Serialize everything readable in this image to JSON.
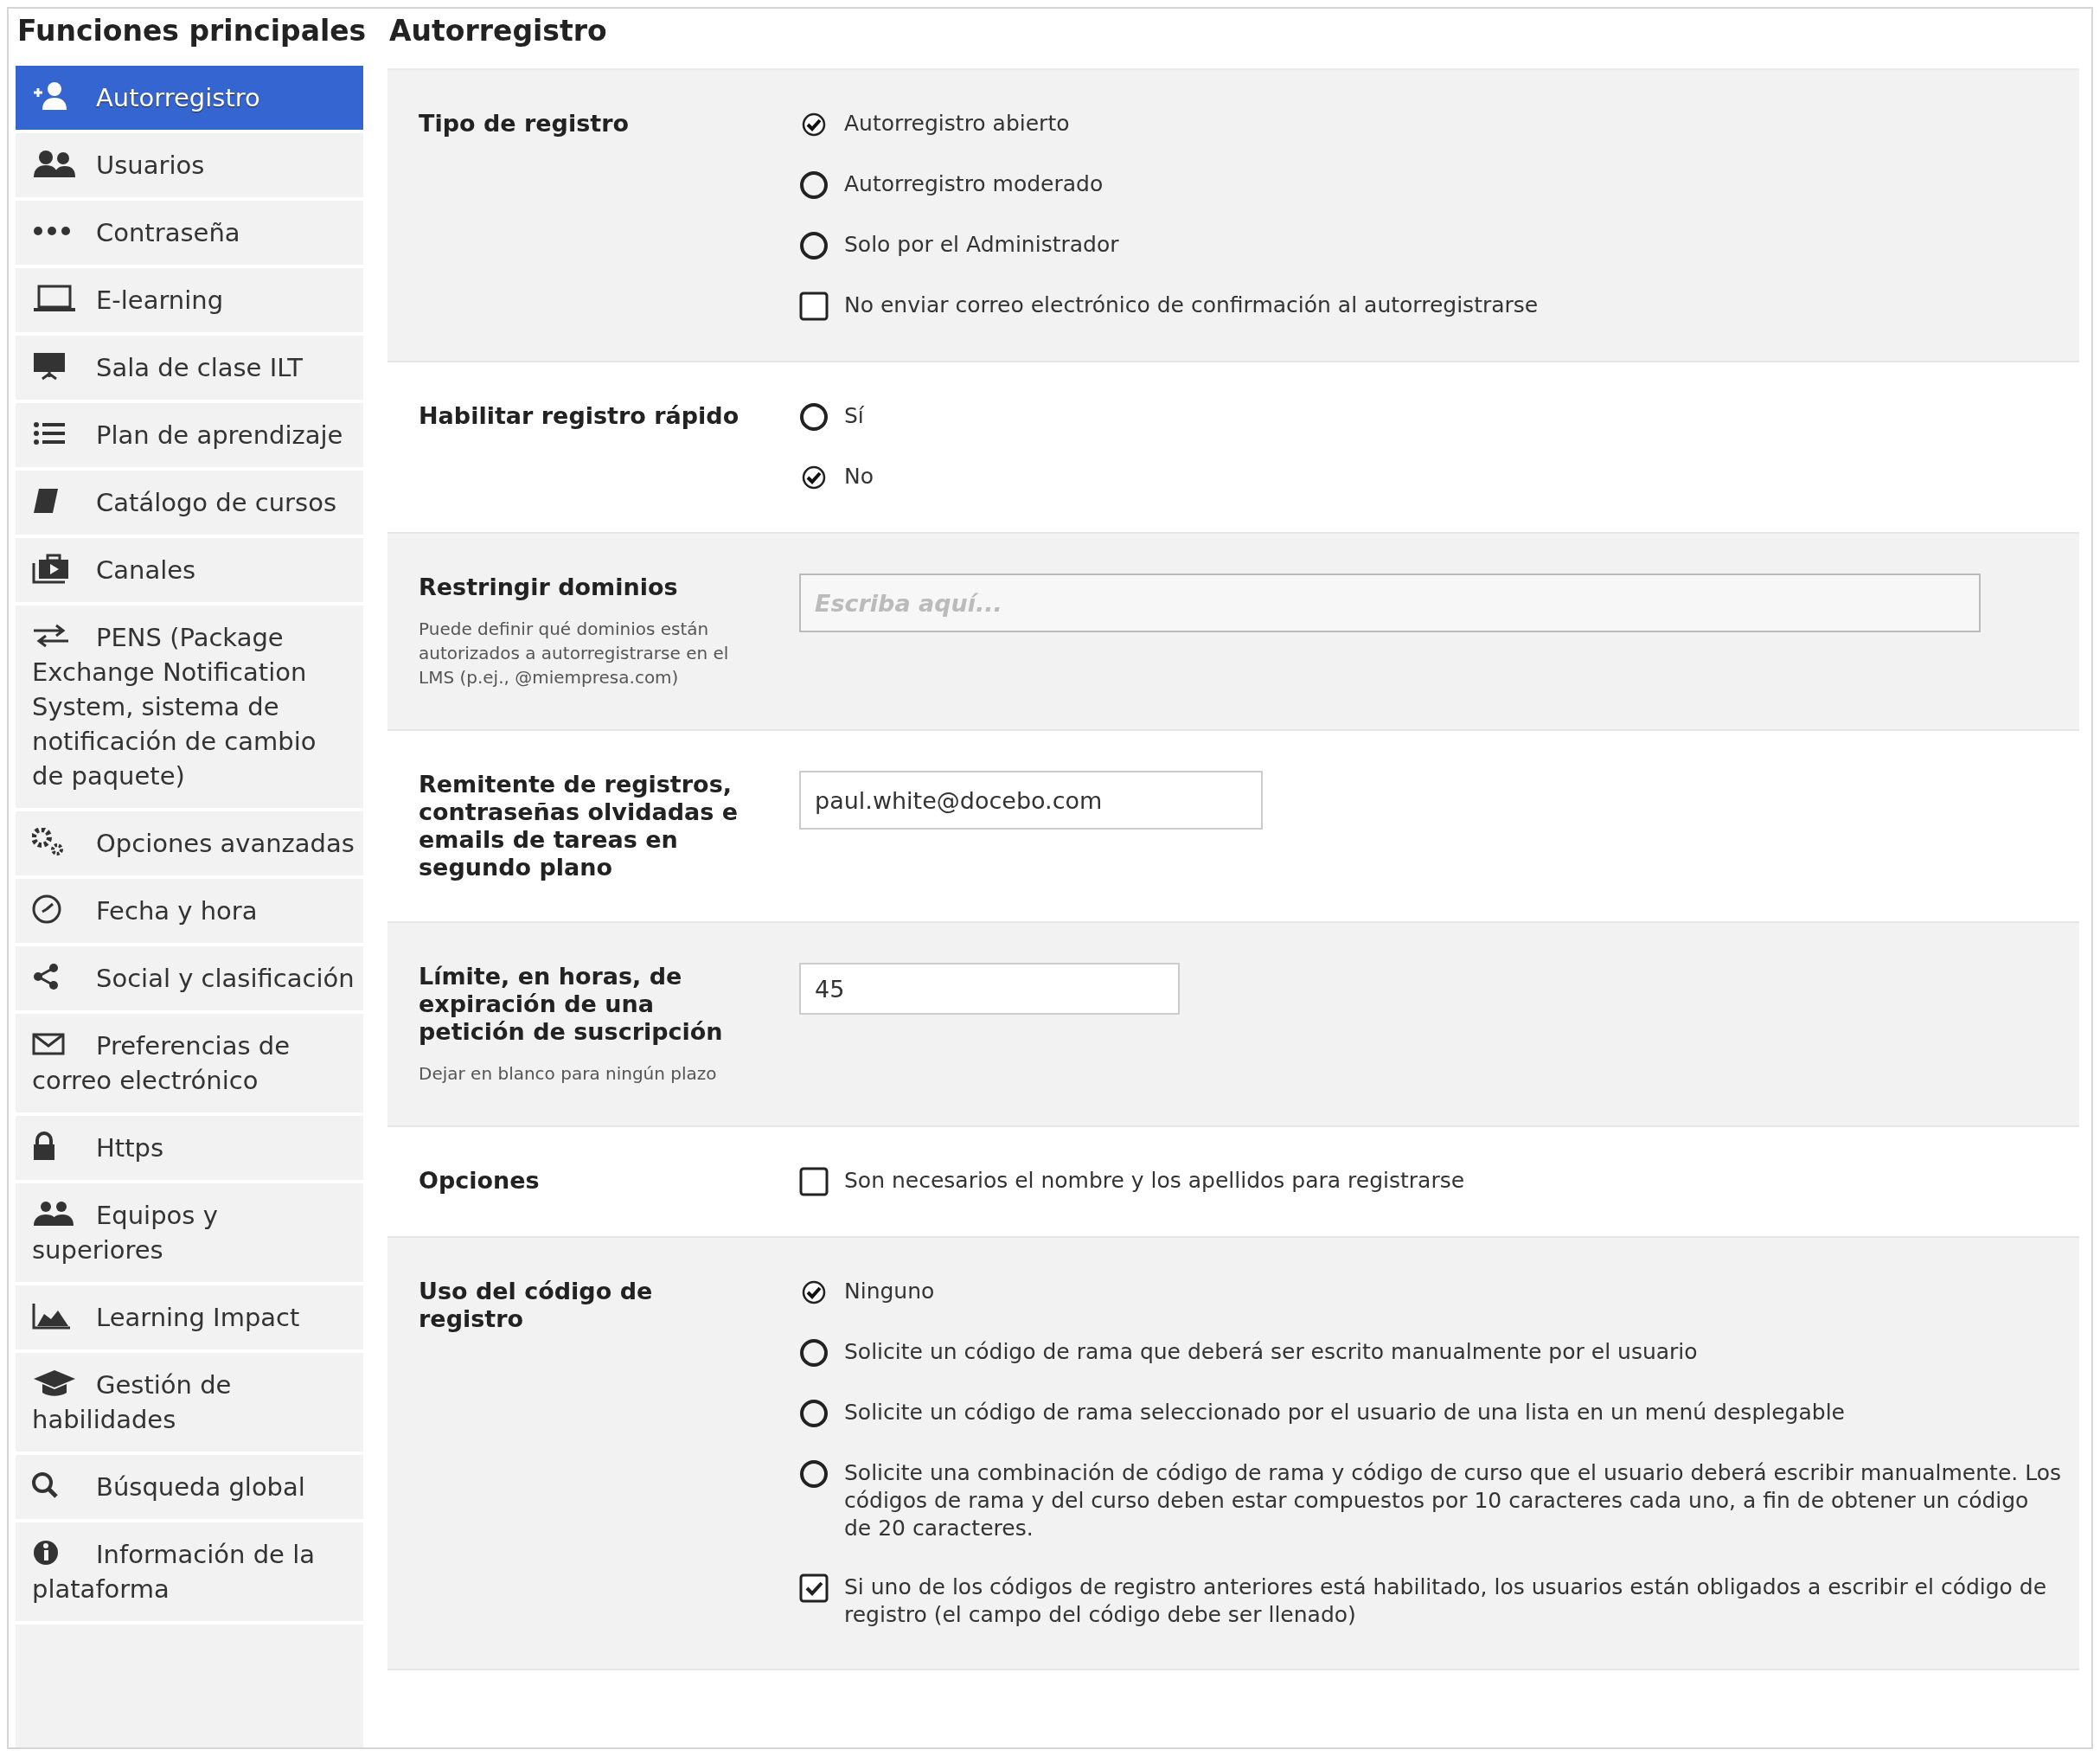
{
  "sidebar": {
    "title": "Funciones principales",
    "items": [
      {
        "label": "Autorregistro",
        "selected": true
      },
      {
        "label": "Usuarios",
        "selected": false
      },
      {
        "label": "Contraseña",
        "selected": false
      },
      {
        "label": "E-learning",
        "selected": false
      },
      {
        "label": "Sala de clase ILT",
        "selected": false
      },
      {
        "label": "Plan de aprendizaje",
        "selected": false
      },
      {
        "label": "Catálogo de cursos",
        "selected": false
      },
      {
        "label": "Canales",
        "selected": false
      },
      {
        "label": "PENS (Package Exchange Notification System, sistema de notificación de cambio de paquete)",
        "selected": false
      },
      {
        "label": "Opciones avanzadas",
        "selected": false
      },
      {
        "label": "Fecha y hora",
        "selected": false
      },
      {
        "label": "Social y clasificación",
        "selected": false
      },
      {
        "label": "Preferencias de correo electrónico",
        "selected": false
      },
      {
        "label": "Https",
        "selected": false
      },
      {
        "label": "Equipos y superiores",
        "selected": false
      },
      {
        "label": "Learning Impact",
        "selected": false
      },
      {
        "label": "Gestión de habilidades",
        "selected": false
      },
      {
        "label": "Búsqueda global",
        "selected": false
      },
      {
        "label": "Información de la plataforma",
        "selected": false
      }
    ]
  },
  "main": {
    "title": "Autorregistro",
    "sections": [
      {
        "label": "Tipo de registro",
        "kind": "options",
        "options": [
          {
            "kind": "radio",
            "label": "Autorregistro abierto",
            "selected": true
          },
          {
            "kind": "radio",
            "label": "Autorregistro moderado",
            "selected": false
          },
          {
            "kind": "radio",
            "label": "Solo por el Administrador",
            "selected": false
          },
          {
            "kind": "checkbox",
            "label": "No enviar correo electrónico de confirmación al autorregistrarse",
            "checked": false
          }
        ]
      },
      {
        "label": "Habilitar registro rápido",
        "kind": "options",
        "options": [
          {
            "kind": "radio",
            "label": "Sí",
            "selected": false
          },
          {
            "kind": "radio",
            "label": "No",
            "selected": true
          }
        ]
      },
      {
        "label": "Restringir dominios",
        "help": "Puede definir qué dominios están autorizados a autorregistrarse en el LMS (p.ej., @miempresa.com)",
        "kind": "field",
        "field": {
          "placeholder": "Escriba aquí..."
        }
      },
      {
        "label": "Remitente de registros, contraseñas olvidadas e emails de tareas en segundo plano",
        "kind": "field",
        "field": {
          "value": "paul.white@docebo.com"
        }
      },
      {
        "label": "Límite, en horas, de expiración de una petición de suscripción",
        "help": "Dejar en blanco para ningún plazo",
        "kind": "field",
        "field": {
          "value": "45"
        }
      },
      {
        "label": "Opciones",
        "kind": "options",
        "options": [
          {
            "kind": "checkbox",
            "label": "Son necesarios el nombre y los apellidos para registrarse",
            "checked": false
          }
        ]
      },
      {
        "label": "Uso del código de registro",
        "kind": "options",
        "options": [
          {
            "kind": "radio",
            "label": "Ninguno",
            "selected": true
          },
          {
            "kind": "radio",
            "label": "Solicite un código de rama que deberá ser escrito manualmente por el usuario",
            "selected": false
          },
          {
            "kind": "radio",
            "label": "Solicite un código de rama seleccionado por el usuario de una lista en un menú desplegable",
            "selected": false
          },
          {
            "kind": "radio",
            "label": "Solicite una combinación de código de rama y código de curso que el usuario deberá escribir manualmente. Los códigos de rama y del curso deben estar compuestos por 10 caracteres cada uno, a fin de obtener un código de 20 caracteres.",
            "selected": false
          },
          {
            "kind": "checkbox",
            "label": "Si uno de los códigos de registro anteriores está habilitado, los usuarios están obligados a escribir el código de registro (el campo del código debe ser llenado)",
            "checked": true
          }
        ]
      }
    ]
  }
}
